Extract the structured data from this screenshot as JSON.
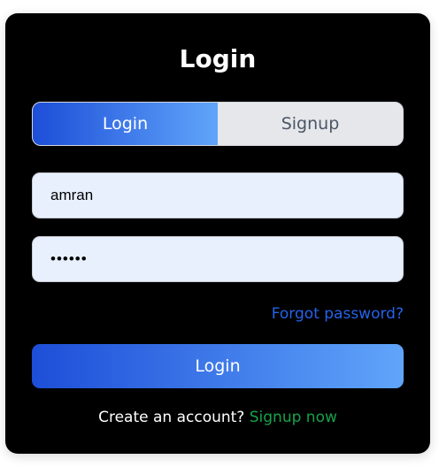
{
  "form": {
    "title": "Login",
    "tabs": [
      {
        "label": "Login",
        "active": true
      },
      {
        "label": "Signup",
        "active": false
      }
    ],
    "username": {
      "value": "amran"
    },
    "password": {
      "value": "••••••"
    },
    "forgot_label": "Forgot password?",
    "submit_label": "Login",
    "signup_prompt": "Create an account?",
    "signup_link": "Signup now"
  },
  "colors": {
    "card_background": "#000000",
    "gradient_start": "#1d4ed8",
    "gradient_end": "#60a5fa",
    "input_background": "#e8f0fe",
    "link_blue": "#2563eb",
    "link_green": "#16a34a"
  }
}
